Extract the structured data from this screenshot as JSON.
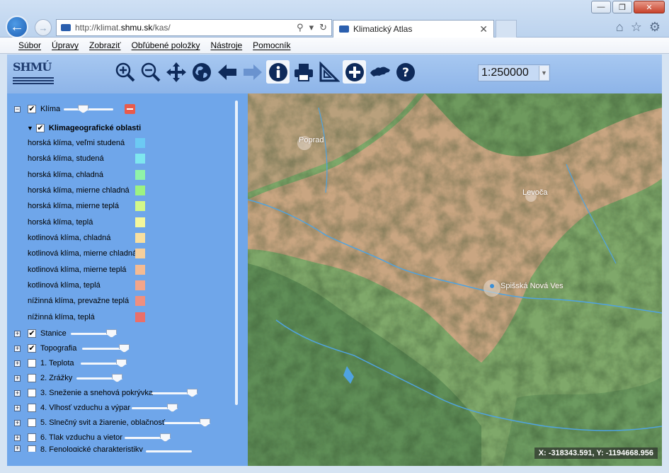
{
  "browser": {
    "url_prefix": "http://klimat.",
    "url_host": "shmu.sk",
    "url_suffix": "/kas/",
    "tab_title": "Klimatický Atlas",
    "menu": [
      "Súbor",
      "Úpravy",
      "Zobraziť",
      "Obľúbené položky",
      "Nástroje",
      "Pomocník"
    ]
  },
  "app": {
    "logo_text": "SHMÚ",
    "scale": "1:250000",
    "tools": [
      "zoom-in-icon",
      "zoom-out-icon",
      "pan-icon",
      "globe-icon",
      "back-arrow-icon",
      "forward-arrow-icon",
      "info-icon",
      "print-icon",
      "measure-icon",
      "add-layer-icon",
      "slovakia-map-icon",
      "help-icon"
    ]
  },
  "panel": {
    "klima": {
      "label": "Klíma"
    },
    "group": {
      "label": "Klimageografické oblasti"
    },
    "legend": [
      {
        "label": "horská klíma, veľmi studená",
        "color": "#6cc9f3"
      },
      {
        "label": "horská klíma, studená",
        "color": "#7ee6ef"
      },
      {
        "label": "horská klíma, chladná",
        "color": "#8ff2a8"
      },
      {
        "label": "horská klíma, mierne chladná",
        "color": "#9cf282"
      },
      {
        "label": "horská klíma, mierne teplá",
        "color": "#d2f889"
      },
      {
        "label": "horská klíma, teplá",
        "color": "#f4f79c"
      },
      {
        "label": "kotlinová klíma, chladná",
        "color": "#f8df9f"
      },
      {
        "label": "kotlinová klíma, mierne chladná",
        "color": "#f6cf9c"
      },
      {
        "label": "kotlinová klíma, mierne teplá",
        "color": "#f4bb93"
      },
      {
        "label": "kotlinová klíma, teplá",
        "color": "#f2a58a"
      },
      {
        "label": "nížinná klíma, prevažne teplá",
        "color": "#ef8f7f"
      },
      {
        "label": "nížinná klíma, teplá",
        "color": "#ea6f6a"
      }
    ],
    "layers": [
      {
        "label": "Stanice",
        "checked": "✔"
      },
      {
        "label": "Topografia",
        "checked": "✔"
      },
      {
        "label": "1. Teplota",
        "checked": ""
      },
      {
        "label": "2. Zrážky",
        "checked": ""
      },
      {
        "label": "3. Sneženie a snehová pokrývka",
        "checked": ""
      },
      {
        "label": "4. Vlhosť vzduchu a výpar",
        "checked": ""
      },
      {
        "label": "5. Slnečný svit a žiarenie, oblačnosť",
        "checked": ""
      },
      {
        "label": "6. Tlak vzduchu a vietor",
        "checked": ""
      },
      {
        "label": "8. Fenologické charakteristiky",
        "checked": ""
      }
    ]
  },
  "map": {
    "places": [
      "Poprad",
      "Levoča",
      "Spišská Nová Ves"
    ],
    "coords": "X: -318343.591, Y: -1194668.956"
  }
}
